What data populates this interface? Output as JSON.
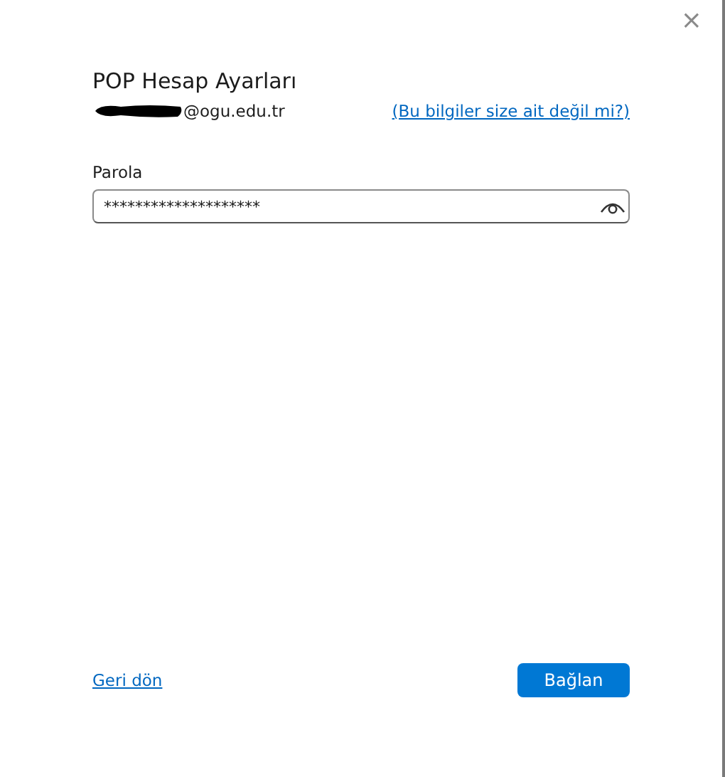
{
  "window": {
    "close": "×"
  },
  "title": "POP Hesap Ayarları",
  "account": {
    "email_domain": "@ogu.edu.tr",
    "redacted": true,
    "not_you_link": "(Bu bilgiler size ait değil mi?)"
  },
  "password": {
    "label": "Parola",
    "value": "********************"
  },
  "footer": {
    "back_link": "Geri dön",
    "connect_button": "Bağlan"
  }
}
